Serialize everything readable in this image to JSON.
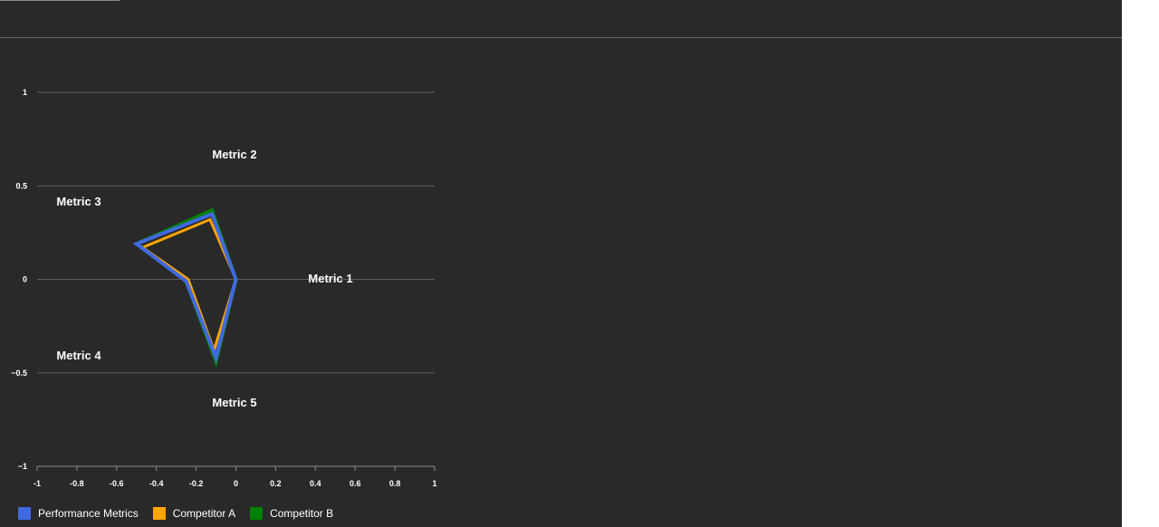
{
  "chart_data": {
    "type": "radar",
    "axes_labels": [
      "Metric 1",
      "Metric 2",
      "Metric 3",
      "Metric 4",
      "Metric 5"
    ],
    "x_ticks": [
      "-1",
      "-0.8",
      "-0.6",
      "-0.4",
      "-0.2",
      "0",
      "0.2",
      "0.4",
      "0.6",
      "0.8",
      "1"
    ],
    "y_ticks": [
      "1",
      "0.5",
      "0",
      "−0.5",
      "−1"
    ],
    "xlim": [
      -1,
      1
    ],
    "ylim": [
      -1,
      1
    ],
    "grid": "horizontal",
    "legend_position": "bottom-left",
    "series": [
      {
        "name": "Performance Metrics",
        "color": "#4169e1",
        "points": [
          [
            0,
            0
          ],
          [
            -0.12,
            0.35
          ],
          [
            -0.5,
            0.19
          ],
          [
            -0.25,
            -0.01
          ],
          [
            -0.1,
            -0.42
          ]
        ]
      },
      {
        "name": "Competitor A",
        "color": "#ffa500",
        "points": [
          [
            0,
            0
          ],
          [
            -0.13,
            0.32
          ],
          [
            -0.47,
            0.17
          ],
          [
            -0.24,
            0.0
          ],
          [
            -0.11,
            -0.38
          ]
        ]
      },
      {
        "name": "Competitor B",
        "color": "#008000",
        "points": [
          [
            0,
            0
          ],
          [
            -0.12,
            0.37
          ],
          [
            -0.5,
            0.19
          ],
          [
            -0.25,
            -0.01
          ],
          [
            -0.1,
            -0.44
          ]
        ]
      }
    ]
  }
}
